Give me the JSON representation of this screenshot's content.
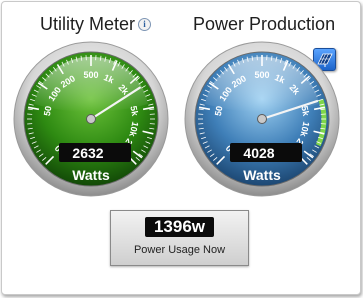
{
  "left_gauge": {
    "title": "Utility Meter",
    "info_icon": "i",
    "value": "2632",
    "reading_watts": 2632,
    "unit": "Watts",
    "face_color": "#2e8a12",
    "band_color": "#ffffff",
    "ticks": [
      "10",
      "50",
      "100",
      "200",
      "500",
      "1k",
      "2k",
      "5k",
      "10k",
      "20k",
      "25k"
    ]
  },
  "right_gauge": {
    "title": "Power Production",
    "solar_icon": "solar-panel-icon",
    "value": "4028",
    "reading_watts": 4028,
    "unit": "Watts",
    "face_color": "#3f7fb8",
    "band_color": "#7fd64a",
    "ticks": [
      "10",
      "50",
      "100",
      "200",
      "500",
      "1k",
      "2k",
      "5k",
      "10k",
      "20k",
      "25k"
    ]
  },
  "usage": {
    "value": "1396w",
    "label": "Power Usage Now"
  }
}
